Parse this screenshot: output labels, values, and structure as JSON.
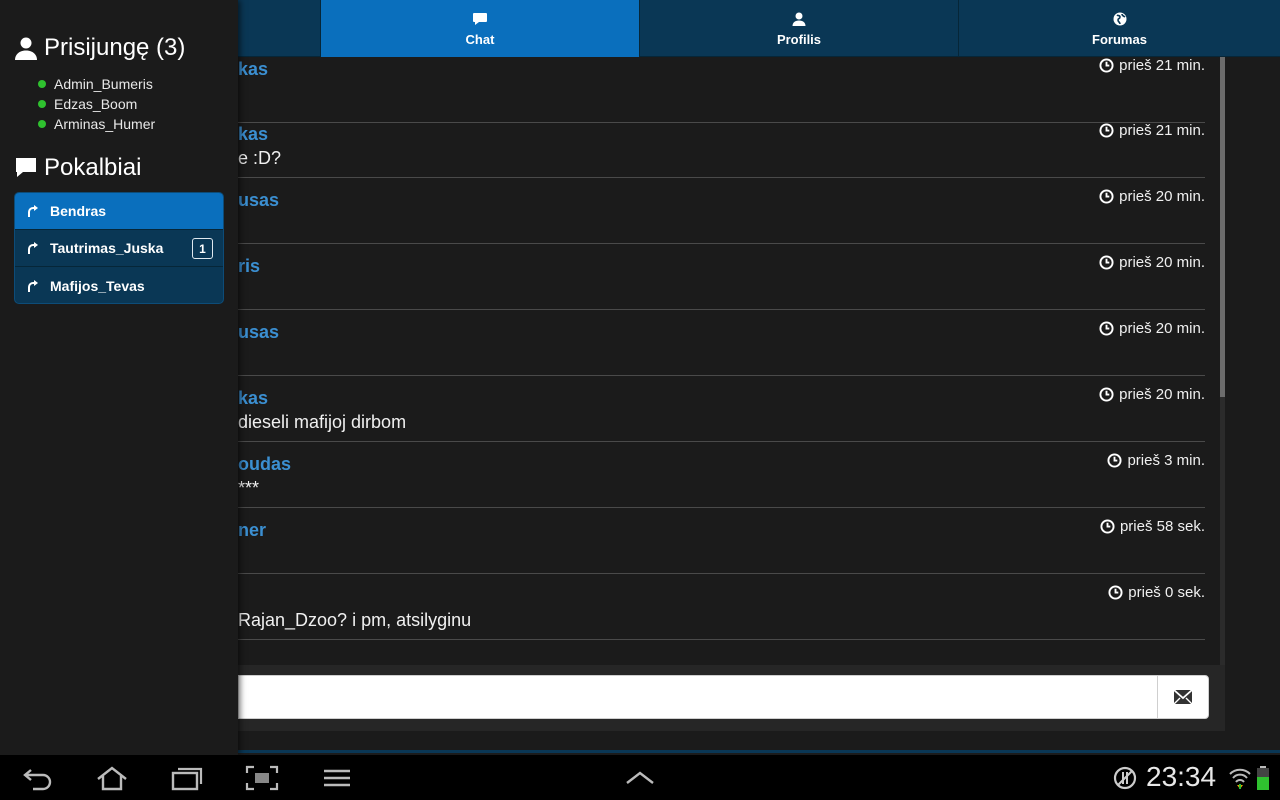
{
  "nav": {
    "tabs": [
      {
        "label": "Chat",
        "icon": "chat-bubble-icon",
        "active": true
      },
      {
        "label": "Profilis",
        "icon": "user-icon",
        "active": false
      },
      {
        "label": "Forumas",
        "icon": "globe-icon",
        "active": false
      }
    ]
  },
  "drawer": {
    "online_title": "Prisijungę (3)",
    "online_users": [
      "Admin_Bumeris",
      "Edzas_Boom",
      "Arminas_Humer"
    ],
    "conversations_title": "Pokalbiai",
    "conversations": [
      {
        "label": "Bendras",
        "active": true,
        "badge": ""
      },
      {
        "label": "Tautrimas_Juska",
        "active": false,
        "badge": "1"
      },
      {
        "label": "Mafijos_Tevas",
        "active": false,
        "badge": ""
      }
    ]
  },
  "chat": {
    "messages": [
      {
        "author": "kas",
        "text": "",
        "time": "prieš 21 min."
      },
      {
        "author": "kas",
        "text": "e :D?",
        "time": "prieš 21 min."
      },
      {
        "author": "usas",
        "text": "",
        "time": "prieš 20 min."
      },
      {
        "author": "ris",
        "text": "",
        "time": "prieš 20 min."
      },
      {
        "author": "usas",
        "text": "",
        "time": "prieš 20 min."
      },
      {
        "author": "kas",
        "text": "dieseli mafijoj dirbom",
        "time": "prieš 20 min."
      },
      {
        "author": "oudas",
        "text": "***",
        "time": "prieš 3 min."
      },
      {
        "author": "ner",
        "text": "",
        "time": "prieš 58 sek."
      },
      {
        "author": "",
        "text": "Rajan_Dzoo? i pm, atsilyginu",
        "time": "prieš 0 sek."
      }
    ],
    "input_value": "",
    "input_placeholder": ""
  },
  "system": {
    "clock": "23:34"
  },
  "colors": {
    "nav_bg": "#0a3755",
    "active_blue": "#0a6fbd",
    "author_blue": "#3b8fd1",
    "online_green": "#2fc12f"
  }
}
